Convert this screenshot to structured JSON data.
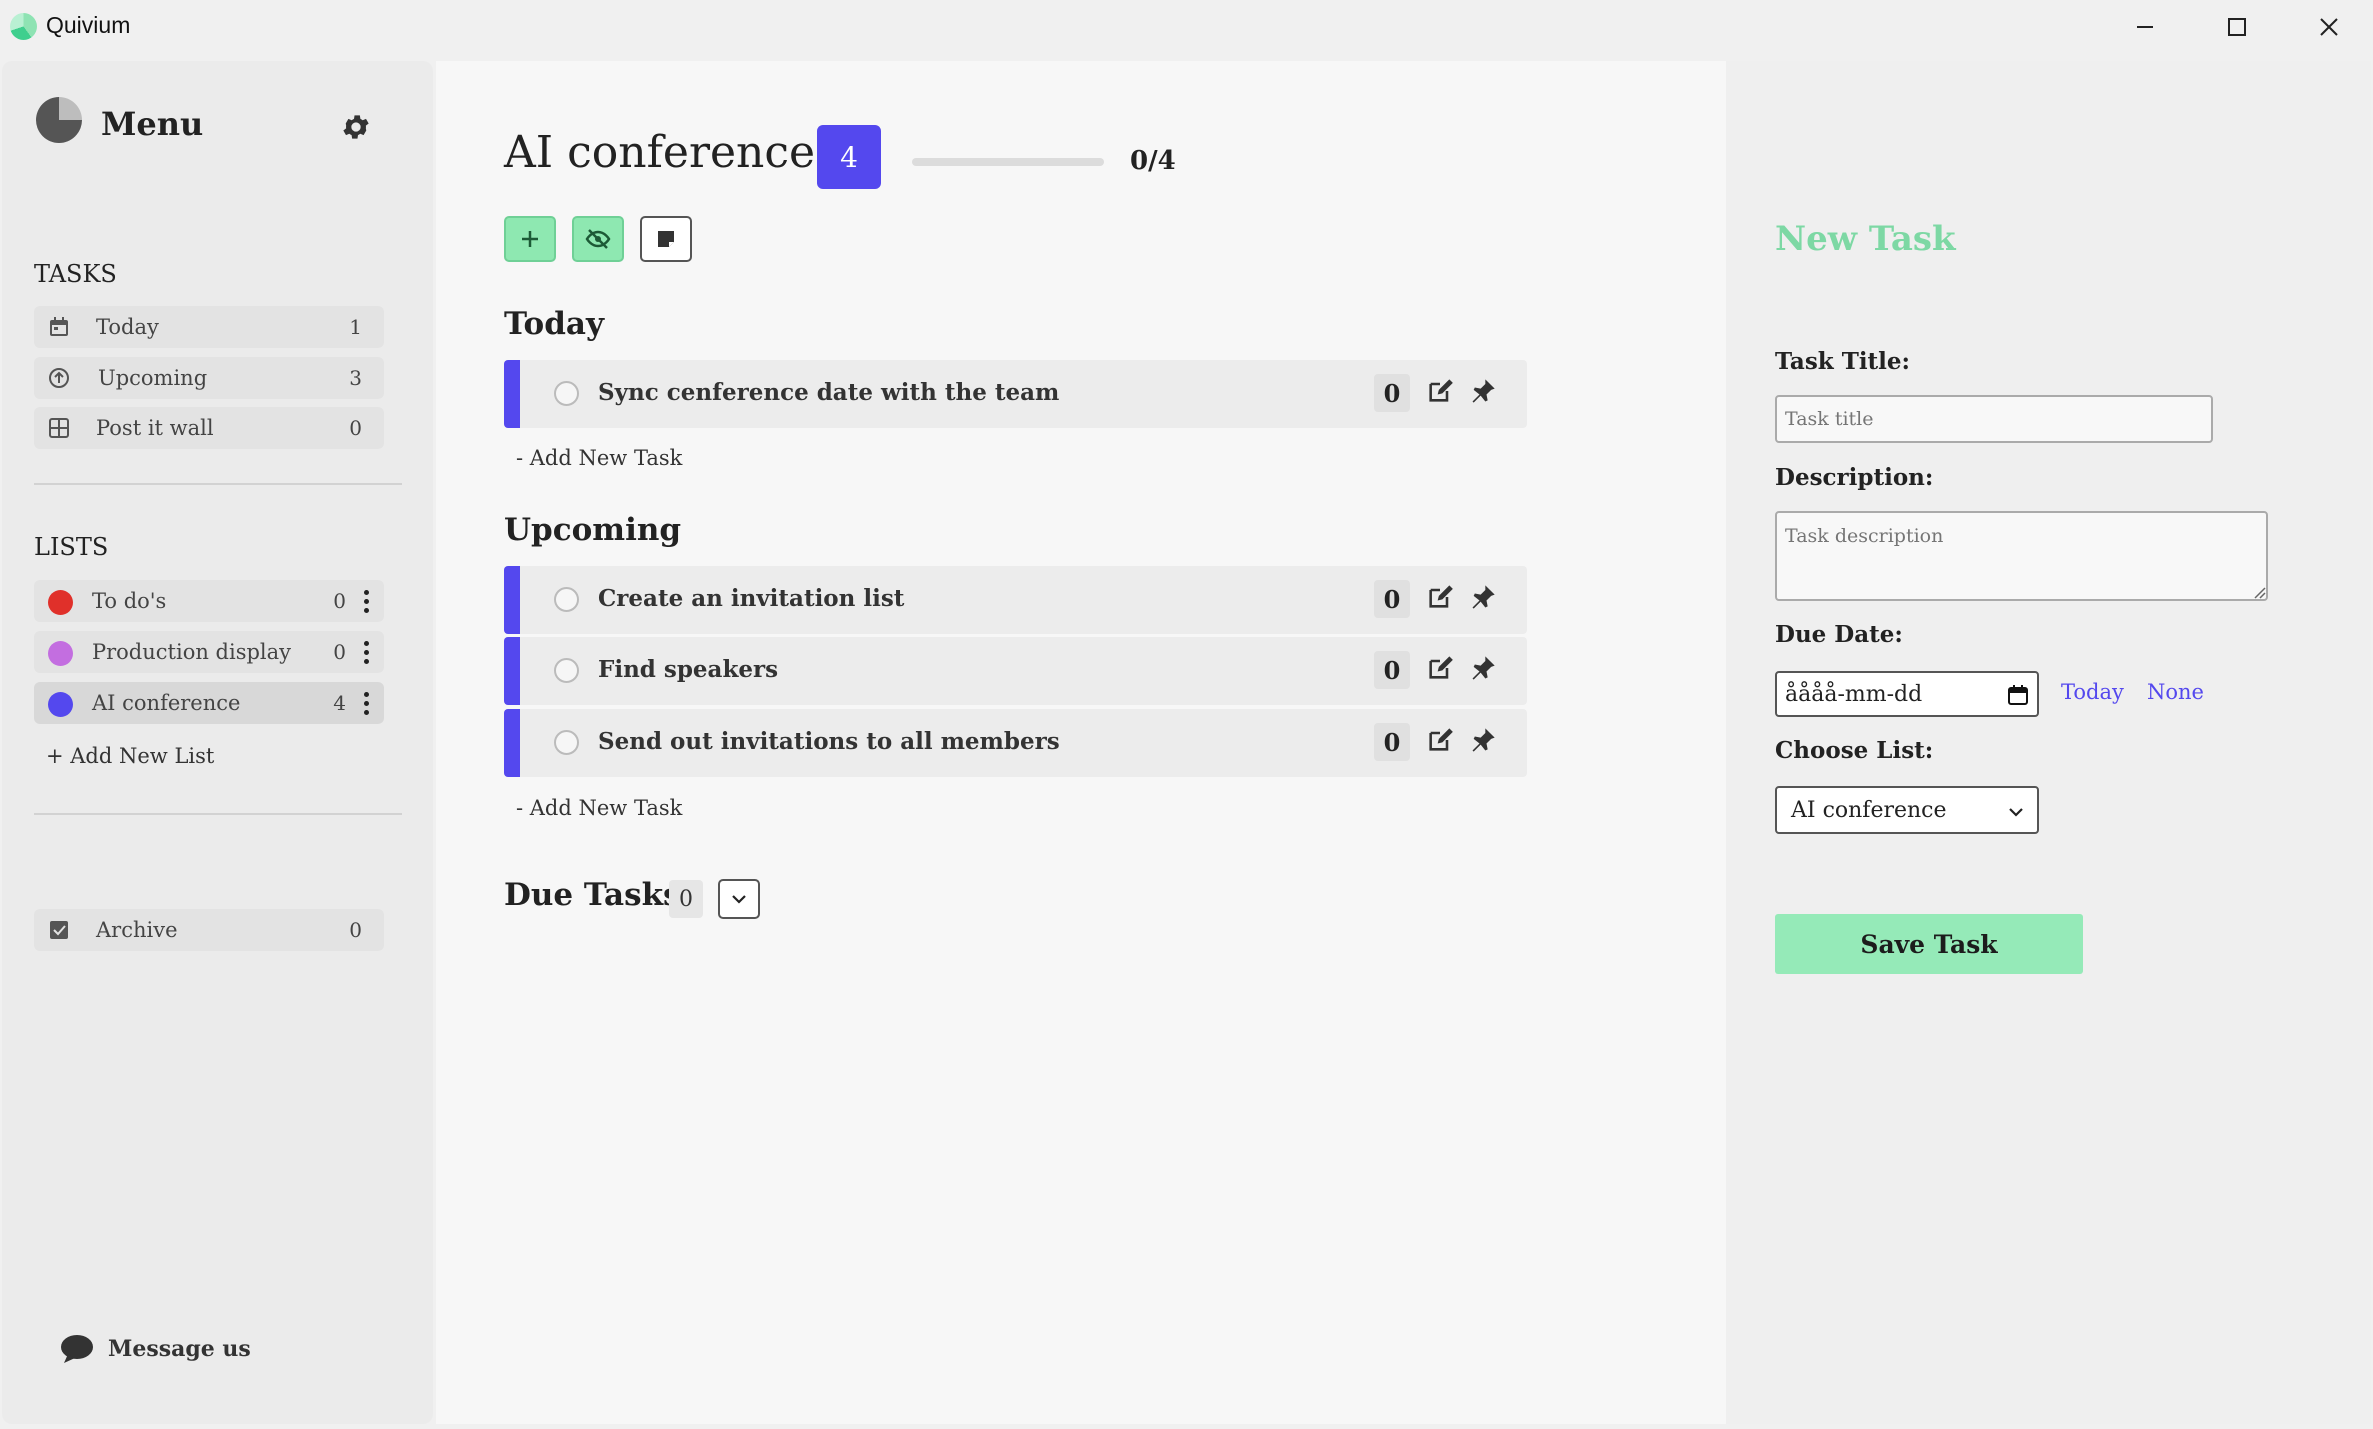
{
  "window": {
    "title": "Quivium",
    "minimize_icon": "minimize-icon",
    "maximize_icon": "maximize-icon",
    "close_icon": "close-icon"
  },
  "sidebar": {
    "title": "Menu",
    "settings_icon": "gear-icon",
    "tasks_heading": "TASKS",
    "task_items": [
      {
        "label": "Today",
        "count": "1",
        "icon": "calendar-icon"
      },
      {
        "label": "Upcoming",
        "count": "3",
        "icon": "arrow-up-circle-icon"
      },
      {
        "label": "Post it wall",
        "count": "0",
        "icon": "grid-icon"
      }
    ],
    "lists_heading": "LISTS",
    "lists": [
      {
        "label": "To do's",
        "count": "0",
        "color": "#e0302a"
      },
      {
        "label": "Production display",
        "count": "0",
        "color": "#c36ee0"
      },
      {
        "label": "AI conference",
        "count": "4",
        "color": "#5448ee",
        "active": true
      }
    ],
    "add_list_label": "+ Add New List",
    "archive": {
      "label": "Archive",
      "count": "0",
      "icon": "checkbox-icon"
    },
    "message_label": "Message us",
    "message_icon": "chat-bubble-icon"
  },
  "main": {
    "list_title": "AI conference",
    "task_count": "4",
    "progress_text": "0/4",
    "progress_fraction": 0,
    "accent_color": "#5448ee",
    "toolbar": {
      "add_icon": "plus-icon",
      "hide_icon": "eye-slash-icon",
      "sticky_icon": "sticky-note-icon"
    },
    "groups": [
      {
        "title": "Today",
        "tasks": [
          {
            "title": "Sync cenference date with the team",
            "count": "0"
          }
        ],
        "add_label": "- Add New Task"
      },
      {
        "title": "Upcoming",
        "tasks": [
          {
            "title": "Create an invitation list",
            "count": "0"
          },
          {
            "title": "Find speakers",
            "count": "0"
          },
          {
            "title": "Send out invitations to all members",
            "count": "0"
          }
        ],
        "add_label": "- Add New Task"
      }
    ],
    "due_tasks": {
      "title": "Due Tasks",
      "count": "0"
    }
  },
  "panel": {
    "title": "New Task",
    "title_color": "#7dd8a4",
    "task_title_label": "Task Title:",
    "task_title_placeholder": "Task title",
    "description_label": "Description:",
    "description_placeholder": "Task description",
    "due_date_label": "Due Date:",
    "due_date_value": "åååå-mm-dd",
    "today_link": "Today",
    "none_link": "None",
    "choose_list_label": "Choose List:",
    "selected_list": "AI conference",
    "save_label": "Save Task",
    "save_color": "#95eab8"
  }
}
